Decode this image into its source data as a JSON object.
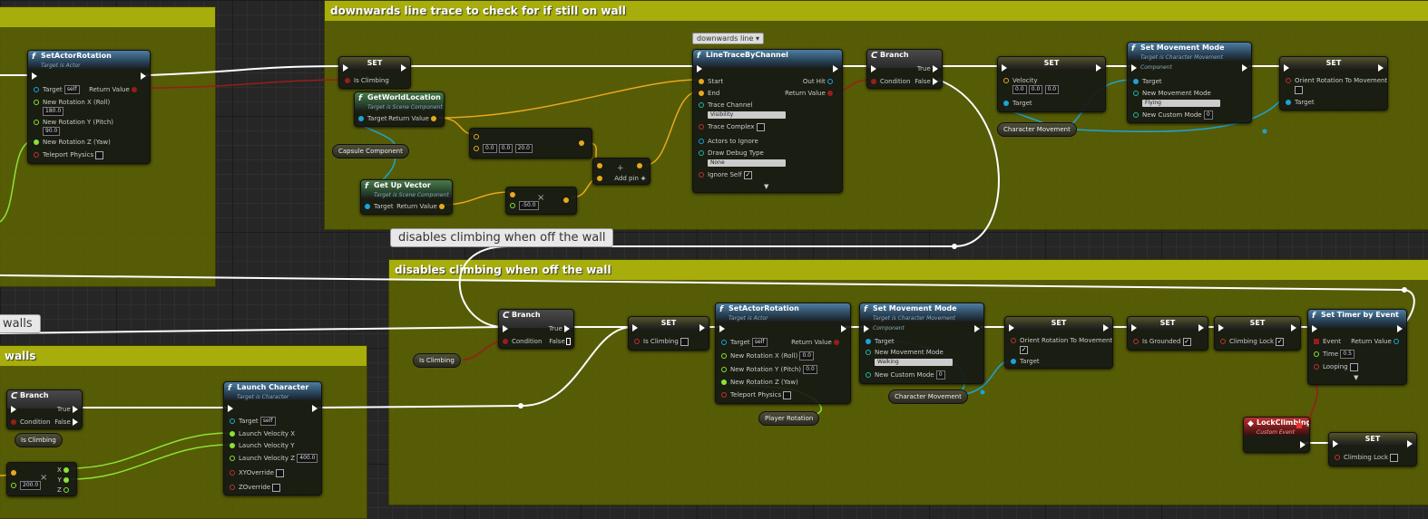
{
  "comments": {
    "top": "downwards line trace to check for if still on wall",
    "bottom": "disables climbing when off the wall",
    "bottom_left": "walls",
    "bubble_main": "disables climbing when off the wall",
    "bubble_left": "walls",
    "trace_tag": "downwards line"
  },
  "nodes": {
    "setActorRot1": {
      "title": "SetActorRotation",
      "sub": "Target is Actor",
      "target": "Target",
      "target_val": "self",
      "rx": "New Rotation X (Roll)",
      "rx_val": "180.0",
      "ry": "New Rotation Y (Pitch)",
      "ry_val": "90.0",
      "rz": "New Rotation Z (Yaw)",
      "tp": "Teleport Physics",
      "ret": "Return Value"
    },
    "set1": {
      "title": "SET",
      "pin": "Is Climbing"
    },
    "getWorldLoc": {
      "title": "GetWorldLocation",
      "sub": "Target is Scene Component",
      "target": "Target",
      "ret": "Return Value"
    },
    "capsule": "Capsule Component",
    "vec1": {
      "x": "0.0",
      "y": "0.0",
      "z": "20.0"
    },
    "getUp": {
      "title": "Get Up Vector",
      "sub": "Target is Scene Component",
      "target": "Target",
      "ret": "Return Value"
    },
    "mul": {
      "val": "-50.0"
    },
    "add": {
      "label": "Add pin"
    },
    "trace": {
      "title": "LineTraceByChannel",
      "start": "Start",
      "end": "End",
      "outhit": "Out Hit",
      "ret": "Return Value",
      "channel": "Trace Channel",
      "channel_val": "Visibility",
      "complex": "Trace Complex",
      "ignore": "Actors to Ignore",
      "debug": "Draw Debug Type",
      "debug_val": "None",
      "self": "Ignore Self"
    },
    "branch1": {
      "title": "Branch",
      "cond": "Condition",
      "t": "True",
      "f": "False"
    },
    "set2": {
      "title": "SET",
      "vel": "Velocity",
      "x": "0.0",
      "y": "0.0",
      "z": "0.0",
      "target": "Target"
    },
    "charMove1": "Character Movement",
    "setMove1": {
      "title": "Set Movement Mode",
      "sub": "Target is Character Movement Component",
      "target": "Target",
      "mode": "New Movement Mode",
      "mode_val": "Flying",
      "custom": "New Custom Mode",
      "custom_val": "0"
    },
    "set3": {
      "title": "SET",
      "orient": "Orient Rotation To Movement",
      "target": "Target"
    },
    "branch2": {
      "title": "Branch",
      "cond": "Condition",
      "t": "True",
      "f": "False"
    },
    "isClimb2": "Is Climbing",
    "set4": {
      "title": "SET",
      "pin": "Is Climbing"
    },
    "setActorRot2": {
      "title": "SetActorRotation",
      "sub": "Target is Actor",
      "target": "Target",
      "target_val": "self",
      "rx": "New Rotation X (Roll)",
      "rx_val": "0.0",
      "ry": "New Rotation Y (Pitch)",
      "ry_val": "0.0",
      "rz": "New Rotation Z (Yaw)",
      "tp": "Teleport Physics",
      "ret": "Return Value"
    },
    "playerRot": "Player Rotation",
    "setMove2": {
      "title": "Set Movement Mode",
      "sub": "Target is Character Movement Component",
      "target": "Target",
      "mode": "New Movement Mode",
      "mode_val": "Walking",
      "custom": "New Custom Mode",
      "custom_val": "0"
    },
    "charMove2": "Character Movement",
    "set5": {
      "title": "SET",
      "orient": "Orient Rotation To Movement",
      "target": "Target"
    },
    "set6": {
      "title": "SET",
      "pin": "Is Grounded"
    },
    "set7": {
      "title": "SET",
      "pin": "Climbing Lock"
    },
    "timer": {
      "title": "Set Timer by Event",
      "event": "Event",
      "time": "Time",
      "time_val": "0.5",
      "loop": "Looping",
      "ret": "Return Value"
    },
    "lockEvent": {
      "title": "LockClimbing",
      "sub": "Custom Event"
    },
    "set8": {
      "title": "SET",
      "pin": "Climbing Lock"
    },
    "branch3": {
      "title": "Branch",
      "cond": "Condition",
      "t": "True",
      "f": "False"
    },
    "isClimb3": "Is Climbing",
    "launch": {
      "title": "Launch Character",
      "sub": "Target is Character",
      "target": "Target",
      "target_val": "self",
      "vx": "Launch Velocity X",
      "vy": "Launch Velocity Y",
      "vz": "Launch Velocity Z",
      "vz_val": "400.0",
      "xy": "XYOverride",
      "zo": "ZOverride"
    },
    "breakVec": {
      "x": "X",
      "y": "Y",
      "z": "Z",
      "val": "200.0"
    }
  },
  "colors": {
    "comment_header": "#a7ad0b",
    "comment_body": "#626800",
    "exec_wire": "#ffffff",
    "bool_wire": "#9a1c1c",
    "vector_wire": "#e8a91c",
    "object_wire": "#1ba4d6",
    "rotator_wire": "#8ce234"
  }
}
